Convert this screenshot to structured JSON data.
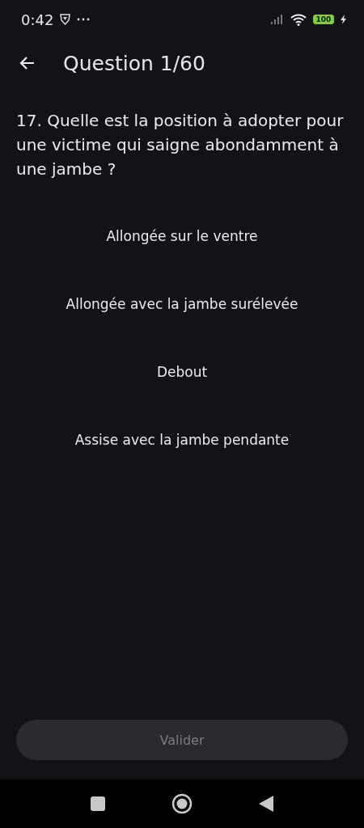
{
  "status_bar": {
    "time": "0:42",
    "battery": "100"
  },
  "header": {
    "title": "Question 1/60"
  },
  "question": "17. Quelle est la position à adopter pour une victime qui saigne abondamment à une jambe ?",
  "answers": [
    {
      "label": "Allongée sur le ventre",
      "selected": false
    },
    {
      "label": "Allongée avec la jambe surélevée",
      "selected": false
    },
    {
      "label": "Debout",
      "selected": false
    },
    {
      "label": "Assise avec la jambe pendante",
      "selected": false
    }
  ],
  "submit": {
    "label": "Valider",
    "disabled": true
  }
}
